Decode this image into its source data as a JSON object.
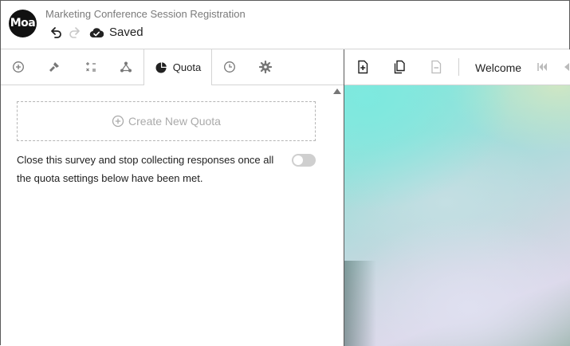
{
  "app": {
    "logo_text": "Moa",
    "title": "Marketing Conference Session Registration",
    "save_status": "Saved"
  },
  "tabs": [
    {
      "icon": "add-circle-icon"
    },
    {
      "icon": "brush-icon"
    },
    {
      "icon": "calculator-icon"
    },
    {
      "icon": "network-icon"
    },
    {
      "icon": "pie-chart-icon",
      "label": "Quota",
      "active": true
    },
    {
      "icon": "clock-icon"
    },
    {
      "icon": "gear-icon"
    }
  ],
  "quota": {
    "create_label": "Create New Quota",
    "close_description": "Close this survey and stop collecting responses once all the quota settings below have been met.",
    "close_toggle_on": false
  },
  "preview": {
    "toolbar": {
      "page_label": "Welcome"
    }
  },
  "colors": {
    "toggle_off": "#cfcfcf",
    "logo_bg": "#111111",
    "preview_teal": "#7de9df"
  }
}
